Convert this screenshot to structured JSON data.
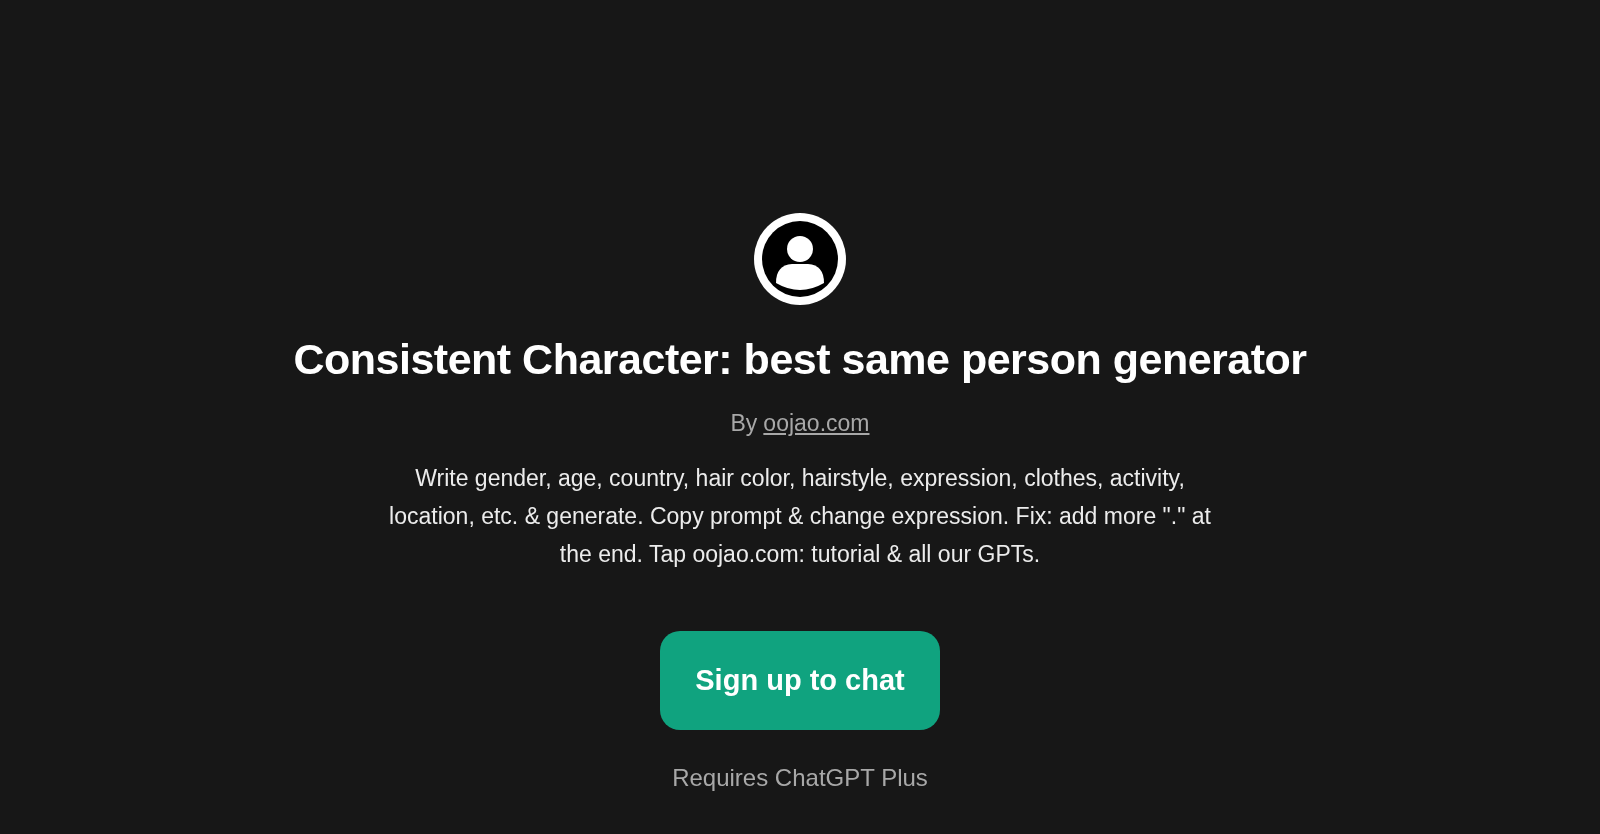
{
  "gpt": {
    "name": "Consistent Character: best same person generator",
    "by_label": "By",
    "author_link": "oojao.com",
    "description": "Write gender, age, country, hair color, hairstyle, expression, clothes, activity, location, etc. & generate. Copy prompt & change expression. Fix: add more \".\" at the end. Tap oojao.com: tutorial & all our GPTs."
  },
  "signup_button": "Sign up to chat",
  "footnote": "Requires ChatGPT Plus"
}
